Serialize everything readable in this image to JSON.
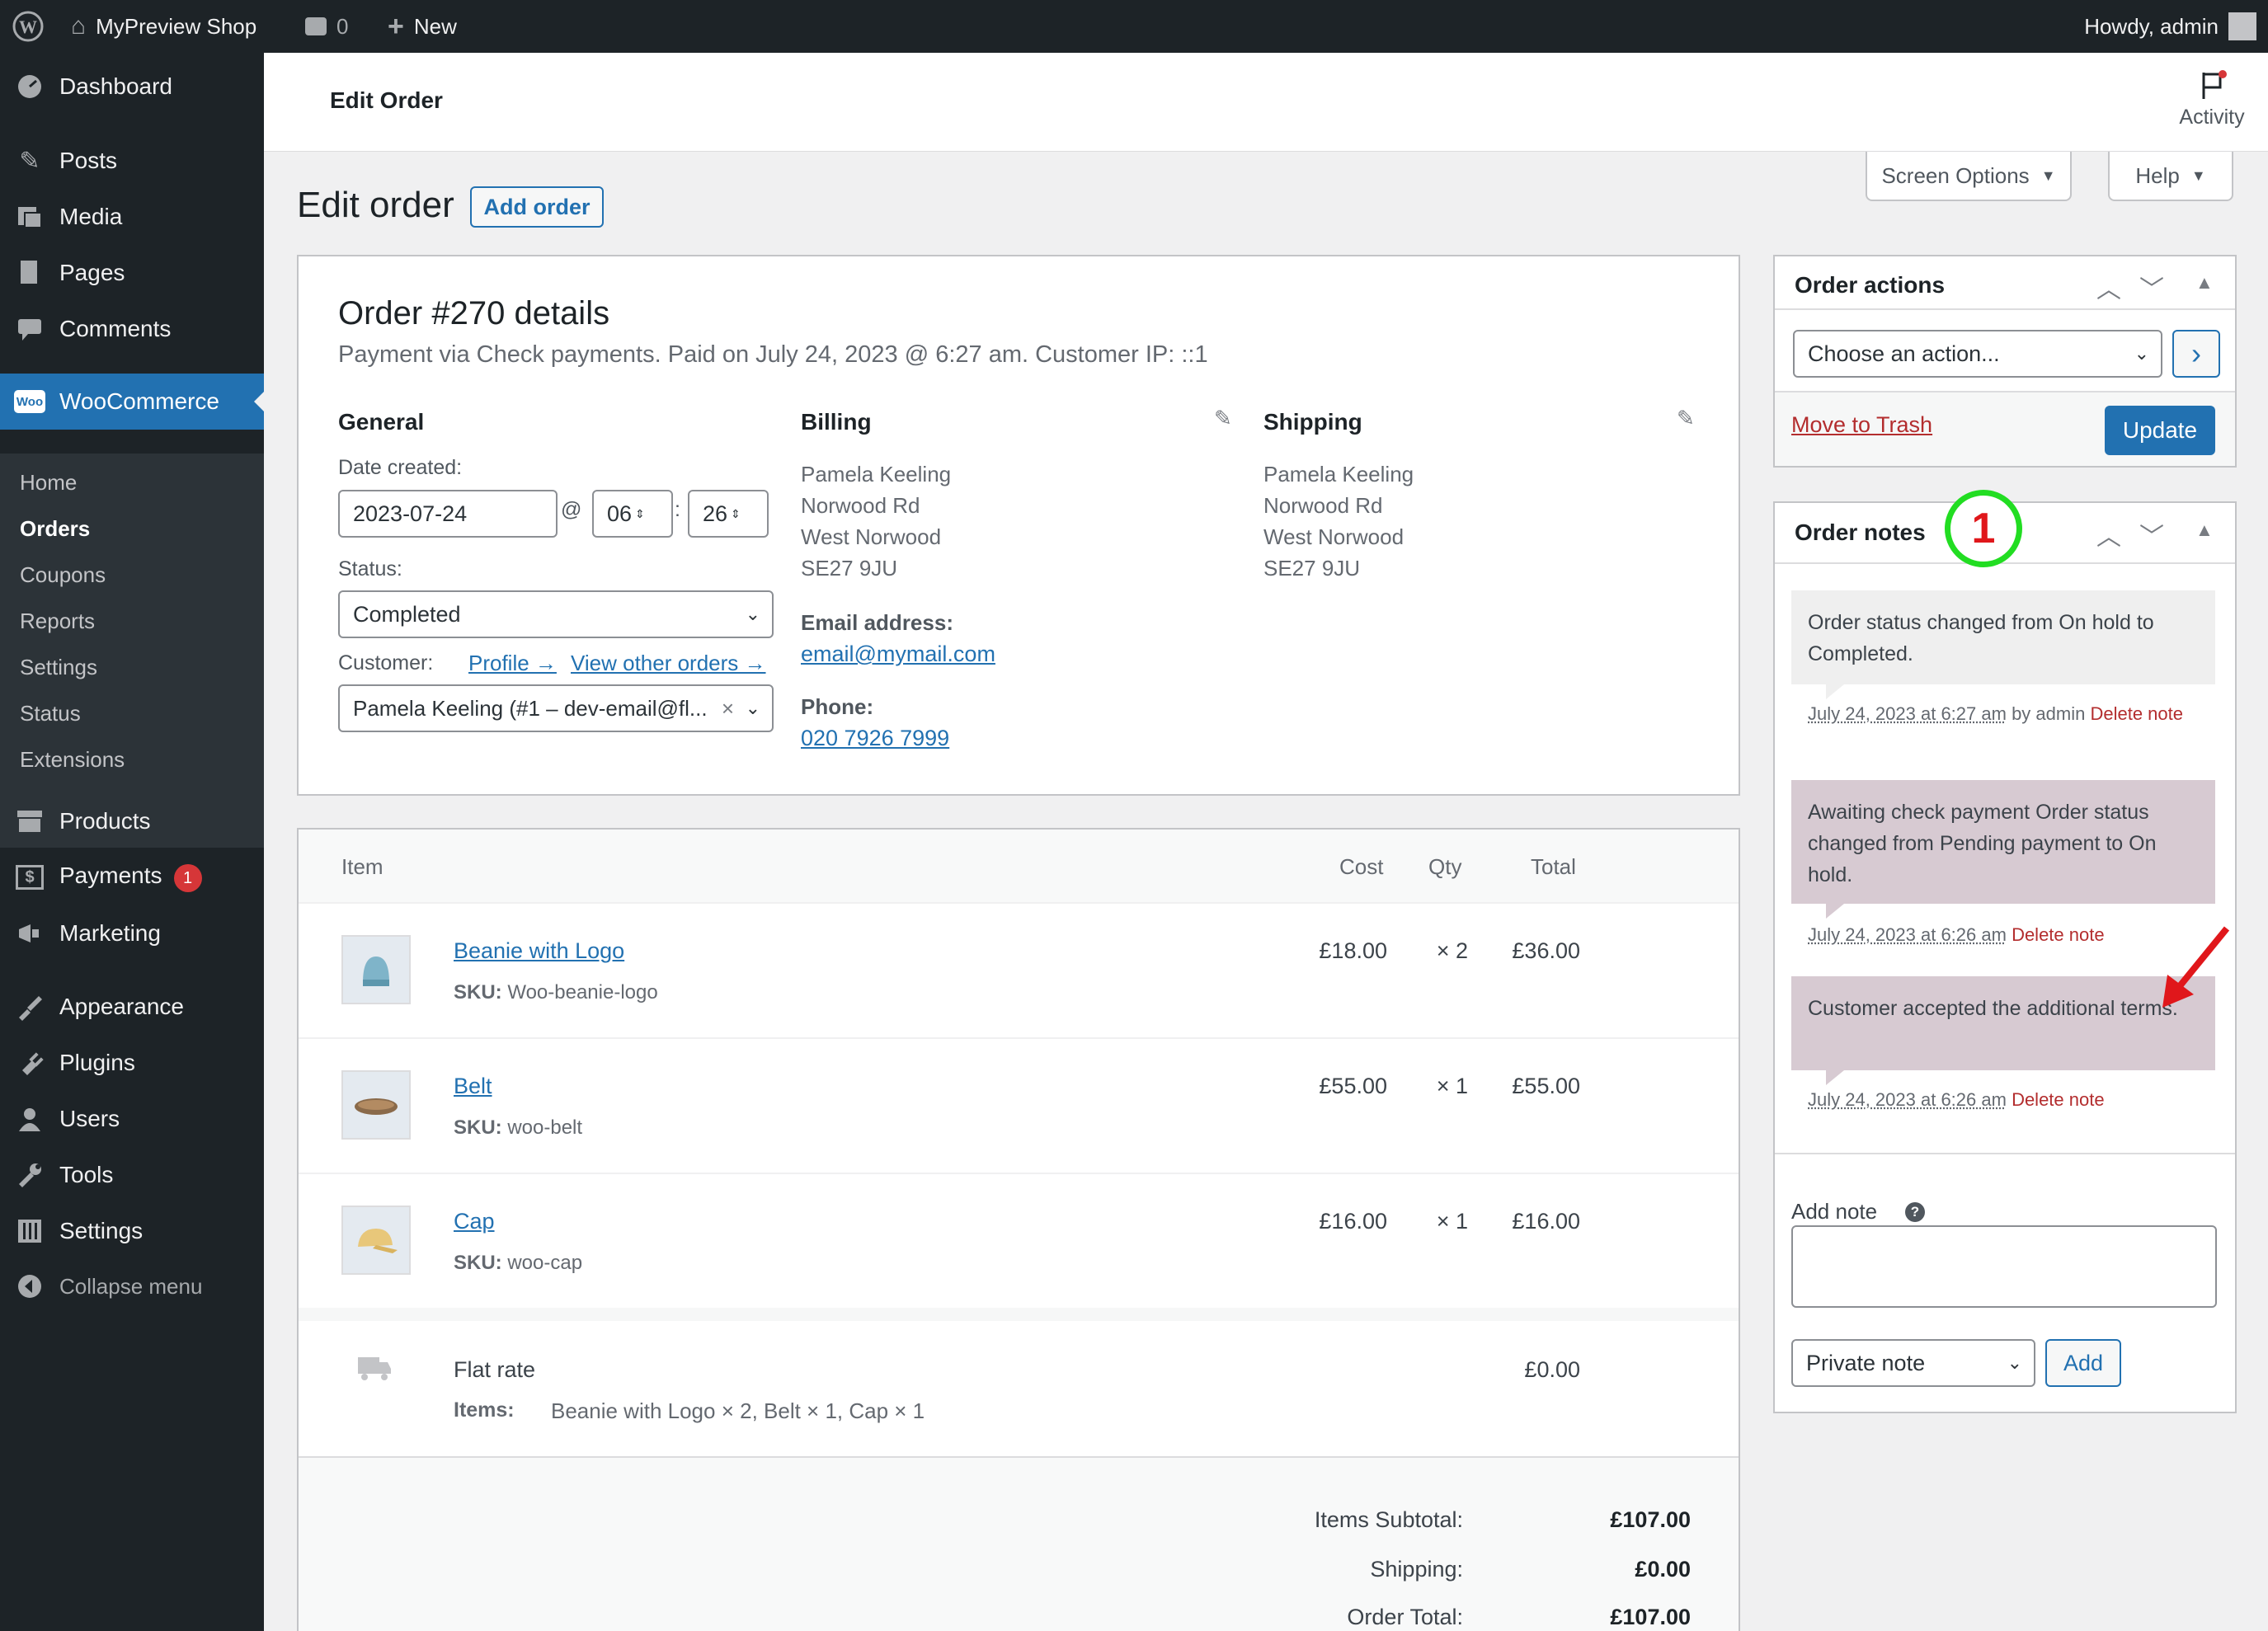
{
  "adminbar": {
    "site_name": "MyPreview Shop",
    "comments_count": "0",
    "new_label": "New",
    "howdy": "Howdy, admin"
  },
  "menu": {
    "dashboard": "Dashboard",
    "posts": "Posts",
    "media": "Media",
    "pages": "Pages",
    "comments": "Comments",
    "woocommerce": "WooCommerce",
    "woo_sub": [
      "Home",
      "Orders",
      "Coupons",
      "Reports",
      "Settings",
      "Status",
      "Extensions"
    ],
    "products": "Products",
    "payments": "Payments",
    "payments_badge": "1",
    "marketing": "Marketing",
    "appearance": "Appearance",
    "plugins": "Plugins",
    "users": "Users",
    "tools": "Tools",
    "settings": "Settings",
    "collapse": "Collapse menu"
  },
  "header": {
    "title": "Edit Order",
    "activity": "Activity"
  },
  "screen_options": "Screen Options",
  "help": "Help",
  "page_title": "Edit order",
  "add_order": "Add order",
  "order": {
    "title": "Order #270 details",
    "subtitle": "Payment via Check payments. Paid on July 24, 2023 @ 6:27 am. Customer IP: ::1",
    "general_heading": "General",
    "date_label": "Date created:",
    "date_value": "2023-07-24",
    "at": "@",
    "colon": ":",
    "hour": "06",
    "minute": "26",
    "status_label": "Status:",
    "status_value": "Completed",
    "customer_label": "Customer:",
    "profile_link": "Profile →",
    "other_orders_link": "View other orders →",
    "customer_value": "Pamela Keeling (#1 – dev-email@fl...",
    "billing_heading": "Billing",
    "billing_address": [
      "Pamela Keeling",
      "Norwood Rd",
      "West Norwood",
      "SE27 9JU"
    ],
    "email_label": "Email address:",
    "email": "email@mymail.com",
    "phone_label": "Phone:",
    "phone": "020 7926 7999",
    "shipping_heading": "Shipping",
    "shipping_address": [
      "Pamela Keeling",
      "Norwood Rd",
      "West Norwood",
      "SE27 9JU"
    ]
  },
  "items_table": {
    "headers": {
      "item": "Item",
      "cost": "Cost",
      "qty": "Qty",
      "total": "Total"
    },
    "sku_label": "SKU:",
    "rows": [
      {
        "name": "Beanie with Logo",
        "sku": "Woo-beanie-logo",
        "cost": "£18.00",
        "qty": "× 2",
        "total": "£36.00"
      },
      {
        "name": "Belt",
        "sku": "woo-belt",
        "cost": "£55.00",
        "qty": "× 1",
        "total": "£55.00"
      },
      {
        "name": "Cap",
        "sku": "woo-cap",
        "cost": "£16.00",
        "qty": "× 1",
        "total": "£16.00"
      }
    ],
    "shipping": {
      "name": "Flat rate",
      "items_label": "Items:",
      "items": "Beanie with Logo × 2, Belt × 1, Cap × 1",
      "total": "£0.00"
    },
    "totals": [
      {
        "label": "Items Subtotal:",
        "value": "£107.00"
      },
      {
        "label": "Shipping:",
        "value": "£0.00"
      },
      {
        "label": "Order Total:",
        "value": "£107.00"
      }
    ]
  },
  "order_actions": {
    "title": "Order actions",
    "select_value": "Choose an action...",
    "go": "›",
    "trash": "Move to Trash",
    "update": "Update"
  },
  "order_notes": {
    "title": "Order notes",
    "step_badge": "1",
    "notes": [
      {
        "text": "Order status changed from On hold to Completed.",
        "date": "July 24, 2023 at 6:27 am",
        "by": "by admin",
        "delete": "Delete note"
      },
      {
        "text": "Awaiting check payment Order status changed from Pending payment to On hold.",
        "date": "July 24, 2023 at 6:26 am",
        "by": "",
        "delete": "Delete note"
      },
      {
        "text": "Customer accepted the additional terms.",
        "date": "July 24, 2023 at 6:26 am",
        "by": "",
        "delete": "Delete note"
      }
    ],
    "add_note_label": "Add note",
    "note_type": "Private note",
    "add_button": "Add"
  },
  "colors": {
    "accent": "#2271b1",
    "sidebar": "#1d2327",
    "annotation_green": "#22dd22",
    "annotation_red": "#e0171b"
  }
}
